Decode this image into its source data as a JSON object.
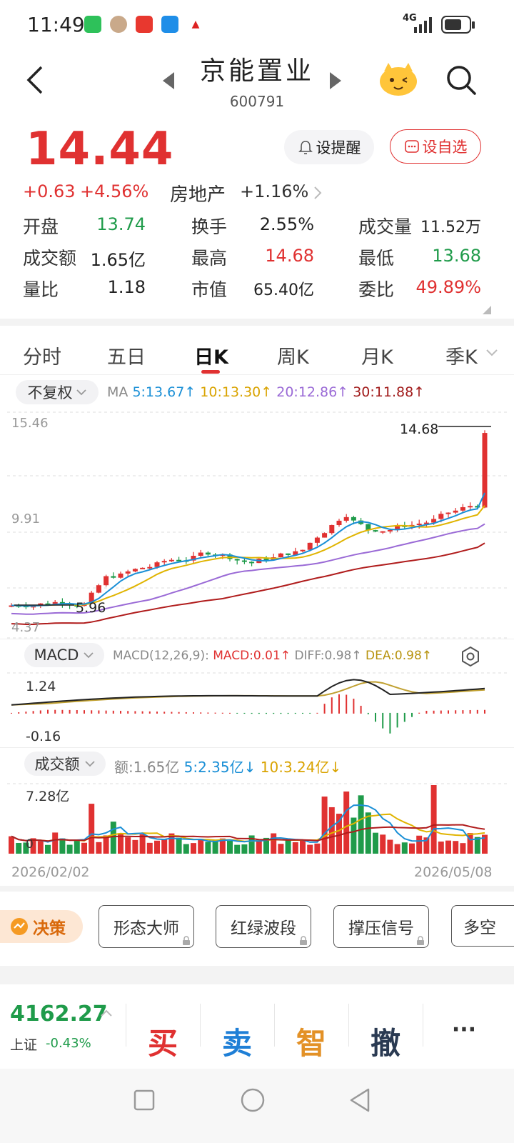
{
  "status_bar": {
    "time": "11:49",
    "network": "4G"
  },
  "header": {
    "name": "京能置业",
    "code": "600791"
  },
  "quote": {
    "price": "14.44",
    "change": "+0.63",
    "change_pct": "+4.56%",
    "sector": "房地产",
    "sector_pct": "+1.16%",
    "alert_label": "设提醒",
    "watch_label": "设自选",
    "stats": [
      {
        "label": "开盘",
        "value": "13.74",
        "color": "green"
      },
      {
        "label": "换手",
        "value": "2.55%",
        "color": "black"
      },
      {
        "label": "成交量",
        "value": "11.52万",
        "color": "black"
      },
      {
        "label": "成交额",
        "value": "1.65亿",
        "color": "black"
      },
      {
        "label": "最高",
        "value": "14.68",
        "color": "red"
      },
      {
        "label": "最低",
        "value": "13.68",
        "color": "green"
      },
      {
        "label": "量比",
        "value": "1.18",
        "color": "black"
      },
      {
        "label": "市值",
        "value": "65.40亿",
        "color": "black"
      },
      {
        "label": "委比",
        "value": "49.89%",
        "color": "red"
      }
    ]
  },
  "tabs": [
    "分时",
    "五日",
    "日K",
    "周K",
    "月K",
    "季K"
  ],
  "active_tab": "日K",
  "kline": {
    "adjust_label": "不复权",
    "ma_label": "MA",
    "ma5": "5:13.67↑",
    "ma10": "10:13.30↑",
    "ma20": "20:12.86↑",
    "ma30": "30:11.88↑",
    "y_top": "15.46",
    "y_mid": "9.91",
    "y_bottom": "4.37",
    "high_label": "14.68",
    "low_label": "5.96"
  },
  "macd": {
    "name": "MACD",
    "params": "MACD(12,26,9):",
    "macd": "MACD:0.01↑",
    "diff": "DIFF:0.98↑",
    "dea": "DEA:0.98↑",
    "y_top": "1.24",
    "y_bottom": "-0.16"
  },
  "volume": {
    "name": "成交额",
    "amount": "额:1.65亿",
    "ma5": "5:2.35亿↓",
    "ma10": "10:3.24亿↓",
    "y_top": "7.28亿",
    "y_zero": "0",
    "date_start": "2026/02/02",
    "date_end": "2026/05/08"
  },
  "tools": {
    "decision": "决策",
    "items": [
      "形态大师",
      "红绿波段",
      "撑压信号",
      "多空"
    ]
  },
  "index": {
    "value": "4162.27",
    "name": "上证",
    "pct": "-0.43%"
  },
  "trade": {
    "buy": "买",
    "sell": "卖",
    "smart": "智",
    "cancel": "撤",
    "more": "···"
  },
  "colors": {
    "up": "#e03131",
    "down": "#1f9b4a",
    "ma5": "#1a8fd6",
    "ma10": "#e0b400",
    "ma20": "#9a6ad6",
    "ma30": "#b01c1c"
  }
}
